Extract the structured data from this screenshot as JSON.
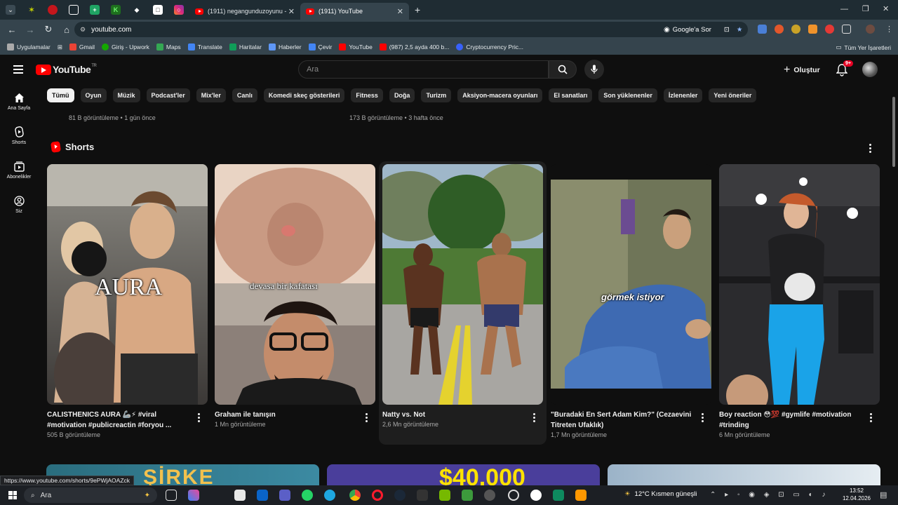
{
  "browser": {
    "tabs": [
      {
        "title": "(1911) negangunduzoyunu - Yo",
        "active": false
      },
      {
        "title": "(1911) YouTube",
        "active": true
      }
    ],
    "url": "youtube.com",
    "google_sor": "Google'a Sor",
    "bookmarks": [
      "Uygulamalar",
      "Gmail",
      "Giriş - Upwork",
      "Maps",
      "Translate",
      "Haritalar",
      "Haberler",
      "Çevir",
      "YouTube",
      "(987) 2,5 ayda 400 b...",
      "Cryptocurrency Pric..."
    ],
    "all_bookmarks": "Tüm Yer İşaretleri",
    "status_url": "https://www.youtube.com/shorts/9ePWjAOAZck"
  },
  "header": {
    "logo": "YouTube",
    "logo_sup": "TR",
    "search_placeholder": "Ara",
    "create_label": "Oluştur",
    "notif_badge": "9+"
  },
  "sidebar": [
    {
      "label": "Ana Sayfa",
      "icon": "home-icon"
    },
    {
      "label": "Shorts",
      "icon": "shorts-icon"
    },
    {
      "label": "Abonelikler",
      "icon": "subscriptions-icon"
    },
    {
      "label": "Siz",
      "icon": "you-icon"
    }
  ],
  "chips": [
    "Tümü",
    "Oyun",
    "Müzik",
    "Podcast'ler",
    "Mix'ler",
    "Canlı",
    "Komedi skeç gösterileri",
    "Fitness",
    "Doğa",
    "Turizm",
    "Aksiyon-macera oyunları",
    "El sanatları",
    "Son yüklenenler",
    "İzlenenler",
    "Yeni öneriler"
  ],
  "previous_row": [
    {
      "meta": "81 B görüntüleme • 1 gün önce"
    },
    {
      "meta": "173 B görüntüleme • 3 hafta önce"
    }
  ],
  "shorts": {
    "heading": "Shorts",
    "items": [
      {
        "title": "CALISTHENICS AURA 🦾⚡ #viral #motivation #publicreactin #foryou ...",
        "views": "505 B görüntüleme",
        "overlay": "AURA"
      },
      {
        "title": "Graham ile tanışın",
        "views": "1 Mn görüntüleme",
        "overlay": "devasa bir kafatası"
      },
      {
        "title": "Natty vs. Not",
        "views": "2,6 Mn görüntüleme",
        "overlay": ""
      },
      {
        "title": "\"Buradaki En Sert Adam Kim?\" (Cezaevini Titreten Ufaklık)",
        "views": "1,7 Mn görüntüleme",
        "overlay": "görmek istiyor"
      },
      {
        "title": "Boy reaction 😳💯 #gymlife #motivation #trinding",
        "views": "6 Mn görüntüleme",
        "overlay": ""
      }
    ]
  },
  "bottom_peek": [
    "ŞİRKE",
    "$40,000"
  ],
  "taskbar": {
    "search_label": "Ara",
    "weather": "12°C  Kısmen güneşli",
    "time": "13:52",
    "date": "12.04.2026"
  }
}
